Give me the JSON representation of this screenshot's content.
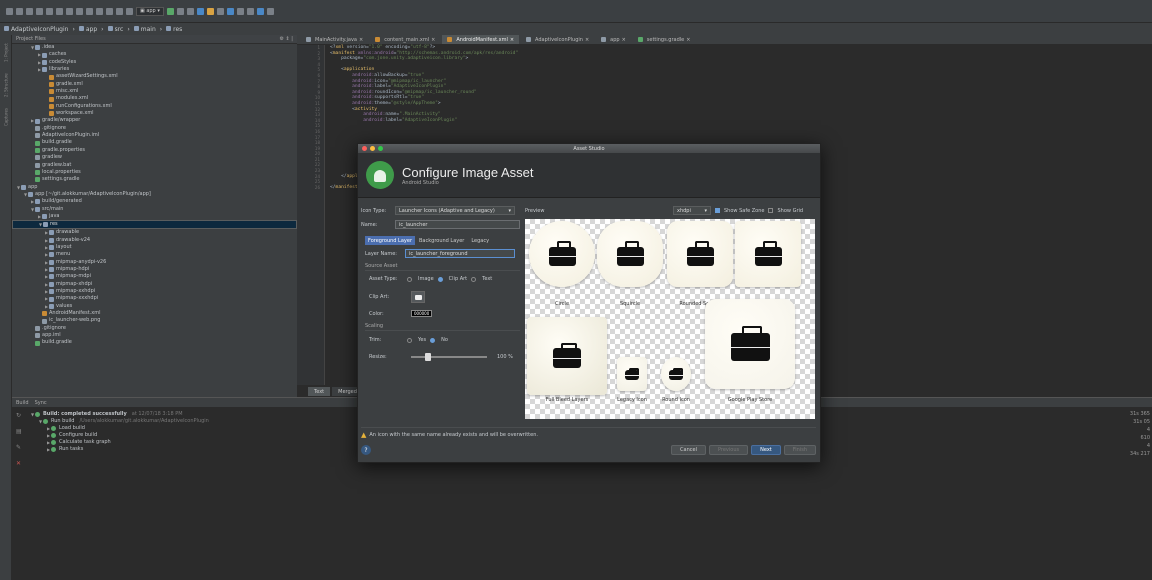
{
  "breadcrumb": [
    "AdaptiveIconPlugin",
    "app",
    "src",
    "main",
    "res"
  ],
  "project": {
    "header": "Project Files",
    "tree": [
      {
        "label": ".idea",
        "indent": 2,
        "type": "folder",
        "open": true
      },
      {
        "label": "caches",
        "indent": 3,
        "type": "folder"
      },
      {
        "label": "codeStyles",
        "indent": 3,
        "type": "folder"
      },
      {
        "label": "libraries",
        "indent": 3,
        "type": "folder"
      },
      {
        "label": "assetWizardSettings.xml",
        "indent": 4,
        "type": "xml"
      },
      {
        "label": "gradle.xml",
        "indent": 4,
        "type": "xml"
      },
      {
        "label": "misc.xml",
        "indent": 4,
        "type": "xml"
      },
      {
        "label": "modules.xml",
        "indent": 4,
        "type": "xml"
      },
      {
        "label": "runConfigurations.xml",
        "indent": 4,
        "type": "xml"
      },
      {
        "label": "workspace.xml",
        "indent": 4,
        "type": "xml"
      },
      {
        "label": "gradle/wrapper",
        "indent": 2,
        "type": "folder"
      },
      {
        "label": ".gitignore",
        "indent": 2,
        "type": "file"
      },
      {
        "label": "AdaptiveIconPlugin.iml",
        "indent": 2,
        "type": "file"
      },
      {
        "label": "build.gradle",
        "indent": 2,
        "type": "grad"
      },
      {
        "label": "gradle.properties",
        "indent": 2,
        "type": "grad"
      },
      {
        "label": "gradlew",
        "indent": 2,
        "type": "file"
      },
      {
        "label": "gradlew.bat",
        "indent": 2,
        "type": "file"
      },
      {
        "label": "local.properties",
        "indent": 2,
        "type": "grad"
      },
      {
        "label": "settings.gradle",
        "indent": 2,
        "type": "grad"
      },
      {
        "label": "app",
        "indent": 0,
        "type": "folder",
        "open": true
      },
      {
        "label": "app [~/git.alokkumar/AdaptiveIconPlugin/app]",
        "indent": 1,
        "type": "folder",
        "open": true
      },
      {
        "label": "build/generated",
        "indent": 2,
        "type": "folder"
      },
      {
        "label": "src/main",
        "indent": 2,
        "type": "folder",
        "open": true
      },
      {
        "label": "java",
        "indent": 3,
        "type": "folder"
      },
      {
        "label": "res",
        "indent": 3,
        "type": "folder",
        "open": true,
        "selected": true
      },
      {
        "label": "drawable",
        "indent": 4,
        "type": "folder"
      },
      {
        "label": "drawable-v24",
        "indent": 4,
        "type": "folder"
      },
      {
        "label": "layout",
        "indent": 4,
        "type": "folder"
      },
      {
        "label": "menu",
        "indent": 4,
        "type": "folder"
      },
      {
        "label": "mipmap-anydpi-v26",
        "indent": 4,
        "type": "folder"
      },
      {
        "label": "mipmap-hdpi",
        "indent": 4,
        "type": "folder"
      },
      {
        "label": "mipmap-mdpi",
        "indent": 4,
        "type": "folder"
      },
      {
        "label": "mipmap-xhdpi",
        "indent": 4,
        "type": "folder"
      },
      {
        "label": "mipmap-xxhdpi",
        "indent": 4,
        "type": "folder"
      },
      {
        "label": "mipmap-xxxhdpi",
        "indent": 4,
        "type": "folder"
      },
      {
        "label": "values",
        "indent": 4,
        "type": "folder"
      },
      {
        "label": "AndroidManifest.xml",
        "indent": 3,
        "type": "xml"
      },
      {
        "label": "ic_launcher-web.png",
        "indent": 3,
        "type": "file"
      },
      {
        "label": ".gitignore",
        "indent": 2,
        "type": "file"
      },
      {
        "label": "app.iml",
        "indent": 2,
        "type": "file"
      },
      {
        "label": "build.gradle",
        "indent": 2,
        "type": "grad"
      }
    ]
  },
  "side_tabs": [
    "1: Project",
    "2: Structure",
    "Captures"
  ],
  "editor_tabs": [
    "MainActivity.java",
    "content_main.xml",
    "AndroidManifest.xml",
    "AdaptiveIconPlugin",
    "app",
    "settings.gradle"
  ],
  "code_lines": [
    "<?xml version=\"1.0\" encoding=\"utf-8\"?>",
    "<manifest xmlns:android=\"http://schemas.android.com/apk/res/android\"",
    "    package=\"com.jone.unity.adaptiveicon.library\">",
    "",
    "    <application",
    "        android:allowBackup=\"true\"",
    "        android:icon=\"@mipmap/ic_launcher\"",
    "        android:label=\"AdaptiveIconPlugin\"",
    "        android:roundIcon=\"@mipmap/ic_launcher_round\"",
    "        android:supportsRtl=\"true\"",
    "        android:theme=\"@style/AppTheme\">",
    "        <activity",
    "            android:name=\".MainActivity\"",
    "            android:label=\"AdaptiveIconPlugin\"",
    "",
    "",
    "",
    "",
    "",
    "",
    "",
    "",
    "",
    "    </application>",
    "",
    "</manifest>"
  ],
  "bottom_editor_tabs": [
    "Text",
    "Merged Manifest"
  ],
  "build": {
    "header": [
      "Build",
      "Sync"
    ],
    "rows": [
      {
        "text": "Build: completed successfully",
        "extra": "at 12/07/18 3:18 PM",
        "indent": 0
      },
      {
        "text": "Run build",
        "extra": "/Users/alokkumar/git.alokkumar/AdaptiveIconPlugin",
        "indent": 1
      },
      {
        "text": "Load build",
        "extra": "",
        "indent": 2
      },
      {
        "text": "Configure build",
        "extra": "",
        "indent": 2
      },
      {
        "text": "Calculate task graph",
        "extra": "",
        "indent": 2
      },
      {
        "text": "Run tasks",
        "extra": "",
        "indent": 2
      }
    ],
    "times": [
      "31s 365",
      "31s 05",
      "4",
      "610",
      "4",
      "34s 217"
    ]
  },
  "dialog": {
    "window_title": "Asset Studio",
    "title": "Configure Image Asset",
    "subtitle": "Android Studio",
    "icon_type_label": "Icon Type:",
    "icon_type_value": "Launcher Icons (Adaptive and Legacy)",
    "name_label": "Name:",
    "name_value": "ic_launcher",
    "layer_tabs": [
      "Foreground Layer",
      "Background Layer",
      "Legacy"
    ],
    "layer_name_label": "Layer Name:",
    "layer_name_value": "ic_launcher_foreground",
    "source_asset": "Source Asset",
    "asset_type_label": "Asset Type:",
    "asset_types": [
      "Image",
      "Clip Art",
      "Text"
    ],
    "clip_art_label": "Clip Art:",
    "color_label": "Color:",
    "color_value": "000000",
    "scaling": "Scaling",
    "trim_label": "Trim:",
    "trim_options": [
      "Yes",
      "No"
    ],
    "resize_label": "Resize:",
    "resize_value": "100 %",
    "resize_fraction": 0.2,
    "preview_label": "Preview",
    "density": "xhdpi",
    "show_safe_zone": "Show Safe Zone",
    "show_grid": "Show Grid",
    "previews": [
      "Circle",
      "Squircle",
      "Rounded Square",
      "Square",
      "Full Bleed Layers",
      "Legacy Icon",
      "Round Icon",
      "Google Play Store"
    ],
    "warning": "An icon with the same name already exists and will be overwritten.",
    "buttons": {
      "cancel": "Cancel",
      "previous": "Previous",
      "next": "Next",
      "finish": "Finish"
    }
  }
}
